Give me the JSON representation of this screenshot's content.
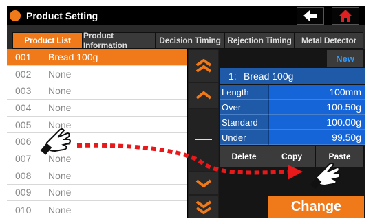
{
  "title_bar": {
    "title": "Product Setting",
    "back_icon": "arrow-left-icon",
    "home_icon": "home-icon",
    "accent_color": "#f07a1a",
    "home_icon_color": "#e02020"
  },
  "tabs": [
    {
      "label": "Product List",
      "active": true
    },
    {
      "label": "Product Information",
      "active": false
    },
    {
      "label": "Decision Timing",
      "active": false
    },
    {
      "label": "Rejection Timing",
      "active": false
    },
    {
      "label": "Metal Detector",
      "active": false
    }
  ],
  "product_list": [
    {
      "num": "001",
      "name": "Bread 100g",
      "selected": true
    },
    {
      "num": "002",
      "name": "None"
    },
    {
      "num": "003",
      "name": "None"
    },
    {
      "num": "004",
      "name": "None"
    },
    {
      "num": "005",
      "name": "None"
    },
    {
      "num": "006",
      "name": "None"
    },
    {
      "num": "007",
      "name": "None"
    },
    {
      "num": "008",
      "name": "None"
    },
    {
      "num": "009",
      "name": "None"
    },
    {
      "num": "010",
      "name": "None"
    }
  ],
  "scroll": {
    "page_up_icon": "double-chevron-up-icon",
    "up_icon": "chevron-up-icon",
    "middle_icon": "dash-icon",
    "down_icon": "chevron-down-icon",
    "page_down_icon": "double-chevron-down-icon"
  },
  "detail": {
    "new_label": "New",
    "header_no": "1:",
    "header_name": "Bread 100g",
    "rows": [
      {
        "label": "Length",
        "value": "100mm"
      },
      {
        "label": "Over",
        "value": "100.50g"
      },
      {
        "label": "Standard",
        "value": "100.00g"
      },
      {
        "label": "Under",
        "value": "99.50g"
      }
    ],
    "delete_label": "Delete",
    "copy_label": "Copy",
    "paste_label": "Paste",
    "change_label": "Change",
    "header_color": "#1e5aa8",
    "value_color": "#1565d8",
    "new_color": "#2f9bff"
  },
  "overlay": {
    "hand_icon": "pointing-hand-icon",
    "arrow_color": "#e8191b",
    "arrow_meaning": "drag-copy-indicator"
  }
}
